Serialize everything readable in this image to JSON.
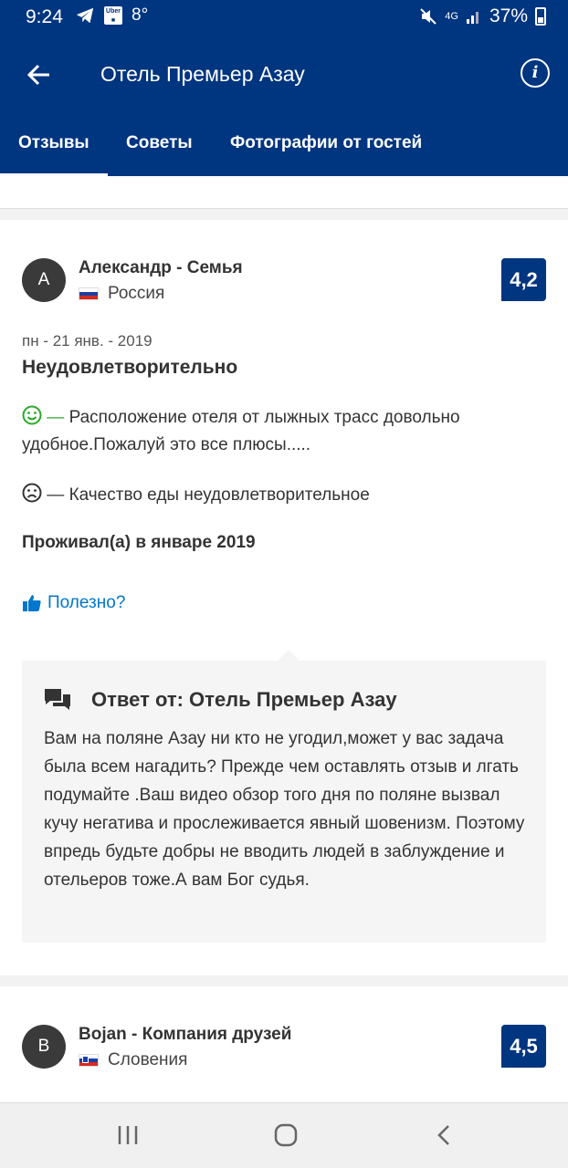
{
  "status_bar": {
    "time": "9:24",
    "temperature": "8°",
    "network": "4G",
    "battery": "37%",
    "icons": [
      "telegram-icon",
      "uber-icon",
      "mute-icon",
      "signal-icon",
      "battery-icon"
    ]
  },
  "header": {
    "title": "Отель Премьер Азау",
    "tabs": [
      {
        "label": "Отзывы",
        "active": true
      },
      {
        "label": "Советы",
        "active": false
      },
      {
        "label": "Фотографии от гостей",
        "active": false
      }
    ]
  },
  "colors": {
    "brand": "#003580",
    "link": "#0077cc",
    "positive": "#2aa82a"
  },
  "reviews": [
    {
      "avatar": "A",
      "name": "Александр - Семья",
      "country": "Россия",
      "score": "4,2",
      "date": "пн - 21 янв. - 2019",
      "title": "Неудовлетворительно",
      "pro_dash": "—",
      "pro": "Расположение отеля  от лыжных трасс довольно удобное.Пожалуй это все плюсы.....",
      "con_dash": "—",
      "con": "Качество еды неудовлетворительное",
      "stayed": "Проживал(а) в январе 2019",
      "helpful": "Полезно?",
      "reply": {
        "title": "Ответ от: Отель Премьер Азау",
        "text": "Вам на поляне Азау ни кто не угодил,может у вас задача была всем нагадить? Прежде чем оставлять отзыв и лгать подумайте .Ваш видео обзор того дня по поляне вызвал кучу негатива и прослеживается явный шовенизм. Поэтому впредь будьте добры не вводить людей в заблуждение и отельеров тоже.А вам Бог судья."
      }
    },
    {
      "avatar": "B",
      "name": "Bojan - Компания друзей",
      "country": "Словения",
      "score": "4,5"
    }
  ]
}
